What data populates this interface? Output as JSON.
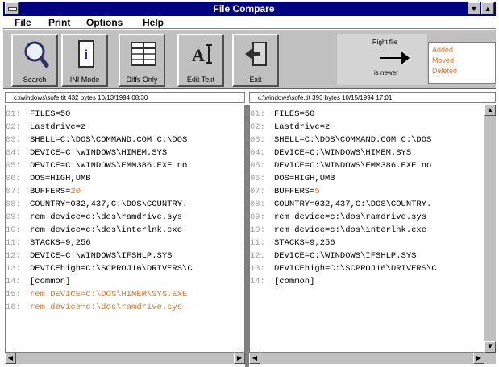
{
  "window": {
    "title": "File Compare",
    "menu": [
      "File",
      "Print",
      "Options",
      "Help"
    ]
  },
  "toolbar": {
    "buttons": [
      {
        "label": "Search",
        "icon": "magnifier-icon"
      },
      {
        "label": "INI Mode",
        "icon": "ini-file-icon"
      },
      {
        "label": "Diffs Only",
        "icon": "table-grid-icon"
      },
      {
        "label": "Edit Text",
        "icon": "edit-text-icon"
      },
      {
        "label": "Exit",
        "icon": "exit-door-icon"
      }
    ],
    "direction_top": "Right file",
    "direction_bottom": "is newer",
    "legend": [
      "Added",
      "Moved",
      "Deleted"
    ]
  },
  "left_pane": {
    "file_info": "c:\\windows\\sofe.tit  432 bytes  10/13/1994  08:30",
    "lines": [
      {
        "num": "01:",
        "text": "FILES=50",
        "changed": false
      },
      {
        "num": "02:",
        "text": "Lastdrive=z",
        "changed": false
      },
      {
        "num": "03:",
        "text": "SHELL=C:\\DOS\\COMMAND.COM C:\\DOS",
        "changed": false
      },
      {
        "num": "04:",
        "text": "DEVICE=C:\\WINDOWS\\HIMEM.SYS",
        "changed": false
      },
      {
        "num": "05:",
        "text": "DEVICE=C:\\WINDOWS\\EMM386.EXE no",
        "changed": false
      },
      {
        "num": "06:",
        "text": "DOS=HIGH,UMB",
        "changed": false
      },
      {
        "num": "07:",
        "text": "BUFFERS=",
        "value": "20",
        "changed": false
      },
      {
        "num": "08:",
        "text": "COUNTRY=032,437,C:\\DOS\\COUNTRY.",
        "changed": false
      },
      {
        "num": "09:",
        "text": "rem  device=c:\\dos\\ramdrive.sys",
        "changed": false
      },
      {
        "num": "10:",
        "text": "rem device=c:\\dos\\interlnk.exe",
        "changed": false
      },
      {
        "num": "11:",
        "text": "STACKS=9,256",
        "changed": false
      },
      {
        "num": "12:",
        "text": "DEVICE=C:\\WINDOWS\\IFSHLP.SYS",
        "changed": false
      },
      {
        "num": "13:",
        "text": "DEVICEhigh=C:\\SCPROJ16\\DRIVERS\\C",
        "changed": false
      },
      {
        "num": "14:",
        "text": "[common]",
        "changed": false
      },
      {
        "num": "15:",
        "text": "rem DEVICE=C:\\DOS\\HIMEM\\SYS.EXE",
        "changed": true
      },
      {
        "num": "16:",
        "text": "rem  device=c:\\dos\\ramdrive.sys",
        "changed": true
      }
    ]
  },
  "right_pane": {
    "file_info": "c:\\windows\\sofe.tit  393 bytes  10/15/1994  17:01",
    "lines": [
      {
        "num": "01:",
        "text": "FILES=50",
        "changed": false
      },
      {
        "num": "02:",
        "text": "Lastdrive=z",
        "changed": false
      },
      {
        "num": "03:",
        "text": "SHELL=C:\\DOS\\COMMAND.COM C:\\DOS",
        "changed": false
      },
      {
        "num": "04:",
        "text": "DEVICE=C:\\WINDOWS\\HIMEM.SYS",
        "changed": false
      },
      {
        "num": "05:",
        "text": "DEVICE=C:\\WINDOWS\\EMM386.EXE no",
        "changed": false
      },
      {
        "num": "06:",
        "text": "DOS=HIGH,UMB",
        "changed": false
      },
      {
        "num": "07:",
        "text": "BUFFERS=",
        "value": "5",
        "changed": false
      },
      {
        "num": "08:",
        "text": "COUNTRY=032,437,C:\\DOS\\COUNTRY.",
        "changed": false
      },
      {
        "num": "09:",
        "text": "rem  device=c:\\dos\\ramdrive.sys",
        "changed": false
      },
      {
        "num": "10:",
        "text": "rem device=c:\\dos\\interlnk.exe",
        "changed": false
      },
      {
        "num": "11:",
        "text": "STACKS=9,256",
        "changed": false
      },
      {
        "num": "12:",
        "text": "DEVICE=C:\\WINDOWS\\IFSHLP.SYS",
        "changed": false
      },
      {
        "num": "13:",
        "text": "DEVICEhigh=C:\\SCPROJ16\\DRIVERS\\C",
        "changed": false
      },
      {
        "num": "14:",
        "text": "[common]",
        "changed": false
      }
    ]
  },
  "colors": {
    "titlebar": "#000080",
    "face": "#c0c0c0",
    "diff": "#f07020"
  }
}
